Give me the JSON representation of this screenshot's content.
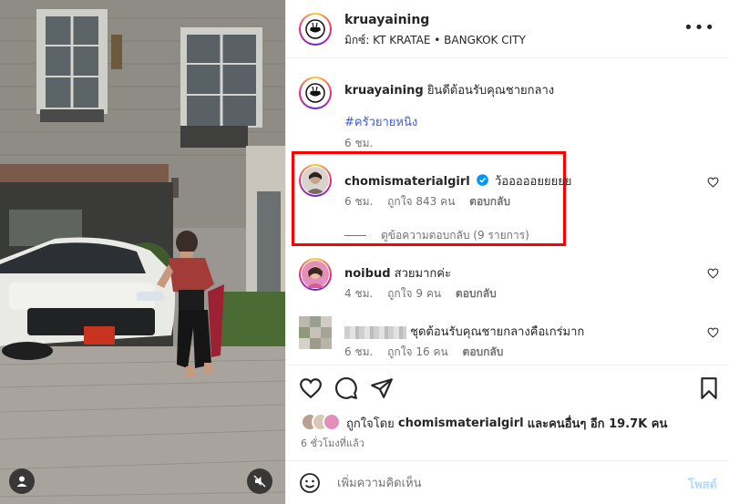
{
  "post": {
    "username": "kruayaining",
    "location": "มิกซ์: KT KRATAE • BANGKOK CITY",
    "more_label": "•••"
  },
  "caption": {
    "username": "kruayaining",
    "text": "ยินดีต้อนรับคุณชายกลาง",
    "hashtag": "#ครัวยายหนิง",
    "time": "6 ชม."
  },
  "comments": [
    {
      "username": "chomismaterialgirl",
      "verified": true,
      "text": "ว้อออออยยยยย",
      "time": "6 ชม.",
      "likes": "ถูกใจ 843 คน",
      "reply_label": "ตอบกลับ",
      "view_replies": "ดูข้อความตอบกลับ (9 รายการ)"
    },
    {
      "username": "noibud",
      "text": "สวยมากค่ะ",
      "time": "4 ชม.",
      "likes": "ถูกใจ 9 คน",
      "reply_label": "ตอบกลับ"
    },
    {
      "username": "",
      "text": "ชุดต้อนรับคุณชายกลางคือเกร่มาก",
      "time": "6 ชม.",
      "likes": "ถูกใจ 16 คน",
      "reply_label": "ตอบกลับ"
    }
  ],
  "liked_by": {
    "prefix": "ถูกใจโดย",
    "user": "chomismaterialgirl",
    "suffix": "และคนอื่นๆ อีก 19.7K คน"
  },
  "time_ago": "6 ชั่วโมงที่แล้ว",
  "comment_box": {
    "placeholder": "เพิ่มความคิดเห็น",
    "post_label": "โพสต์"
  },
  "icons": {
    "like": "heart-icon",
    "comment": "comment-icon",
    "share": "share-icon",
    "save": "bookmark-icon",
    "emoji": "emoji-icon",
    "mute": "mute-icon",
    "tag": "user-tag-icon"
  },
  "colors": {
    "highlight": "#ff0000",
    "verified": "#0095f6",
    "hashtag": "#3b5bdb",
    "post_button": "#b3dbff"
  }
}
